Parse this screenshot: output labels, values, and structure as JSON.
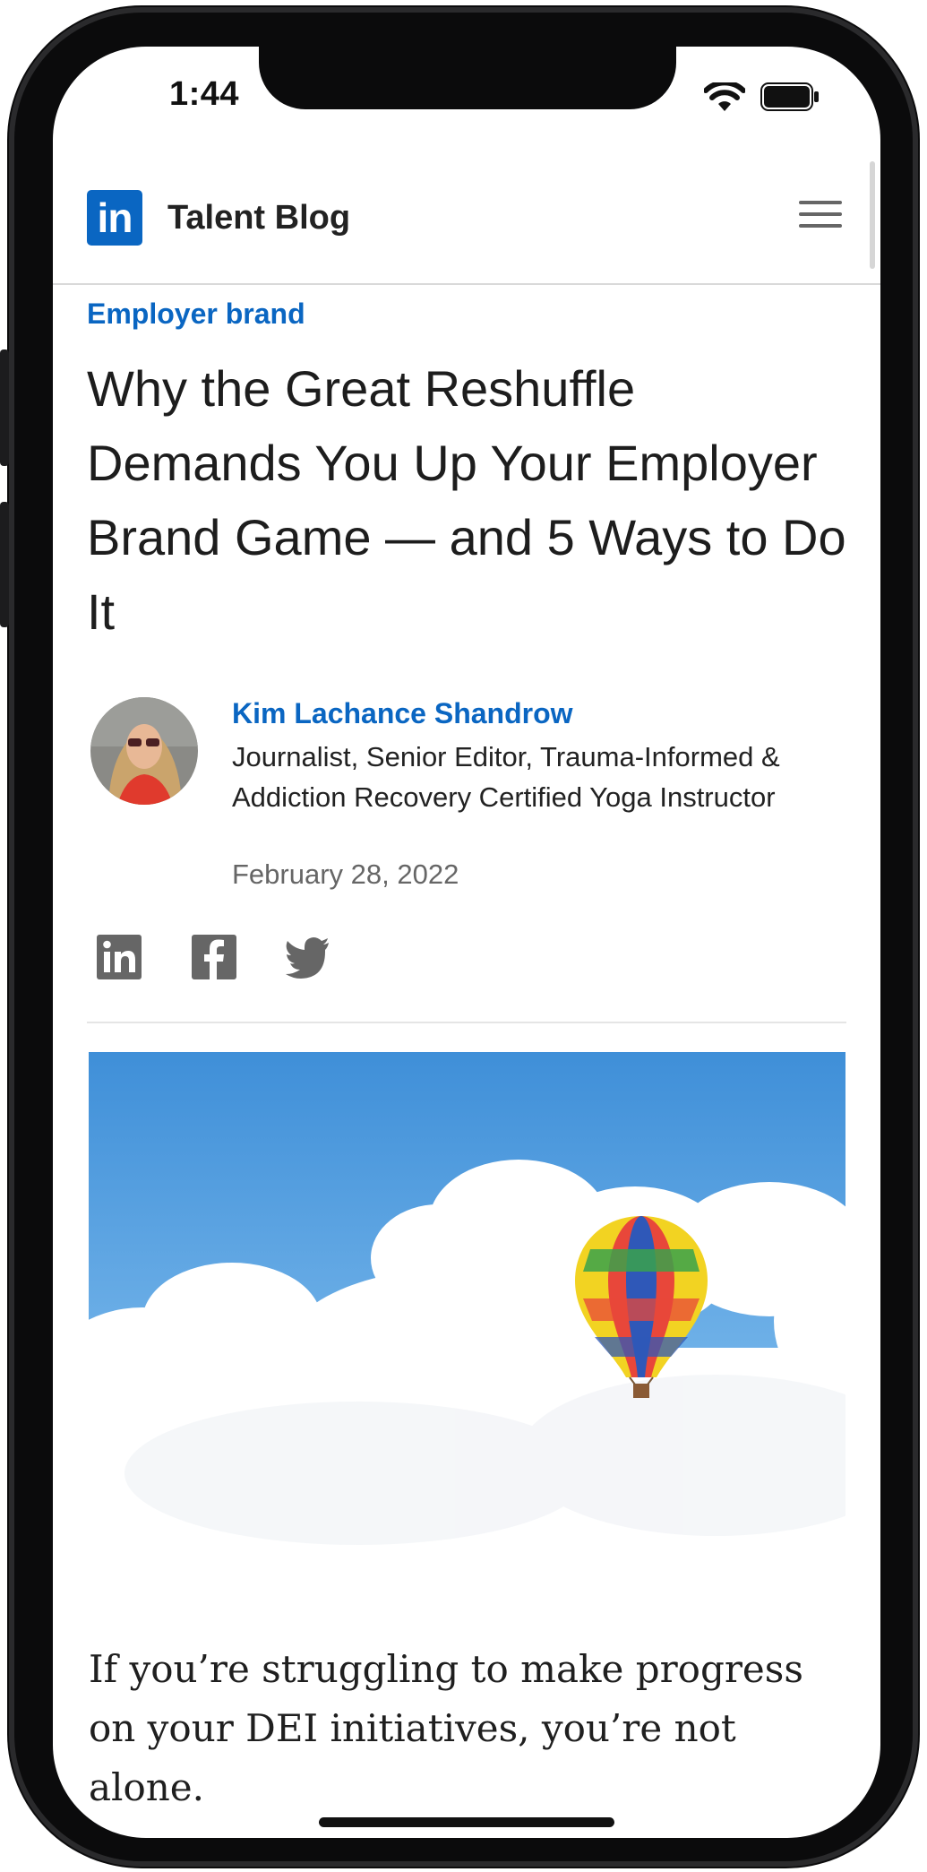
{
  "status_bar": {
    "time": "1:44"
  },
  "header": {
    "logo_text": "in",
    "site_title": "Talent Blog"
  },
  "article": {
    "category": "Employer brand",
    "headline": "Why the Great Reshuffle Demands You Up Your Employer Brand Game — and 5 Ways to Do It",
    "author": {
      "name": "Kim Lachance Shandrow",
      "bio": "Journalist, Senior Editor, Trauma-Informed & Addiction Recovery Certified Yoga Instructor"
    },
    "date": "February 28, 2022",
    "share_icons": [
      "linkedin-icon",
      "facebook-icon",
      "twitter-icon"
    ],
    "body_intro": "If you’re struggling to make progress on your DEI initiatives, you’re not alone."
  },
  "colors": {
    "brand_blue": "#0a66c2",
    "icon_gray": "#666666",
    "sky_blue": "#4f9de0"
  }
}
